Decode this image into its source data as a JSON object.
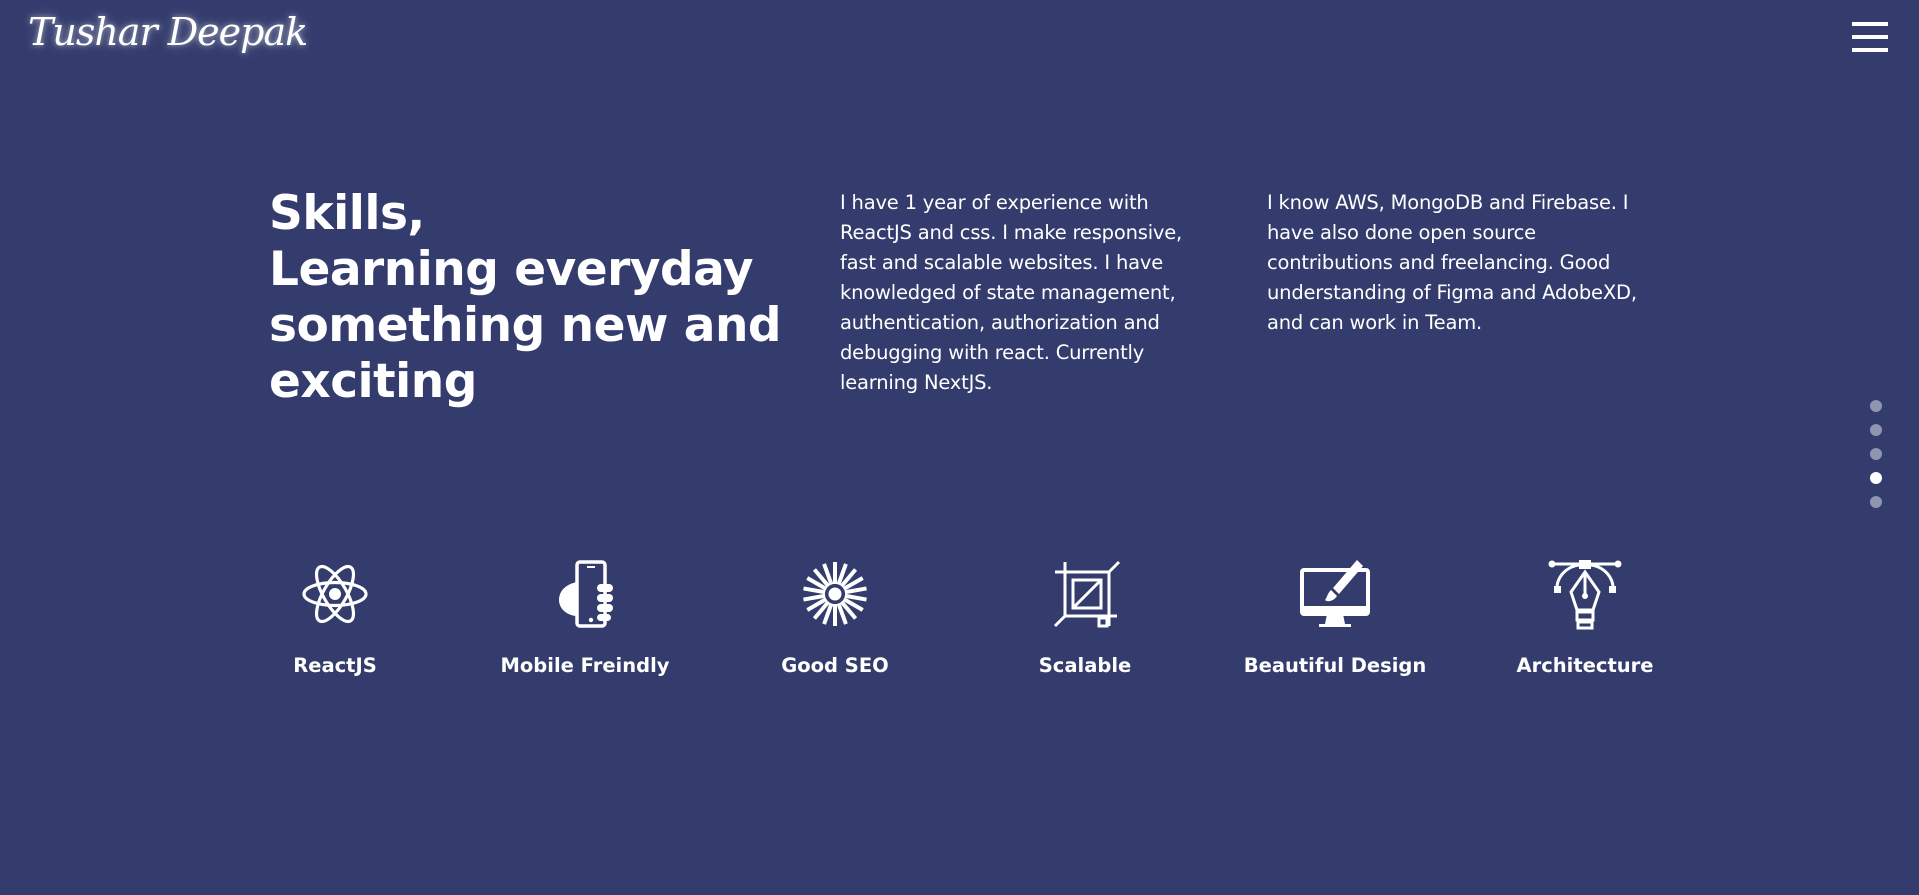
{
  "header": {
    "logo_text": "Tushar Deepak",
    "menu_icon": "hamburger-menu-icon"
  },
  "hero": {
    "heading_lines": [
      "Skills,",
      "Learning everyday",
      "something new and",
      "exciting"
    ],
    "paragraph_1": "I have 1 year of experience with ReactJS and css. I make responsive, fast and scalable websites. I have knowledged of state management, authentication, authorization and debugging with react. Currently learning NextJS.",
    "paragraph_2": "I know AWS, MongoDB and Firebase. I have also done open source contributions and freelancing. Good understanding of Figma and AdobeXD, and can work in Team."
  },
  "section_nav": {
    "total": 5,
    "active_index": 3
  },
  "skills": [
    {
      "label": "ReactJS",
      "icon": "react-atom-icon"
    },
    {
      "label": "Mobile Freindly",
      "icon": "hand-phone-icon"
    },
    {
      "label": "Good SEO",
      "icon": "radial-burst-icon"
    },
    {
      "label": "Scalable",
      "icon": "crop-resize-icon"
    },
    {
      "label": "Beautiful Design",
      "icon": "monitor-brush-icon"
    },
    {
      "label": "Architecture",
      "icon": "pen-tool-icon"
    }
  ],
  "colors": {
    "background": "#333c6d",
    "text": "#ffffff",
    "inactive_dot": "rgba(255,255,255,0.45)"
  }
}
